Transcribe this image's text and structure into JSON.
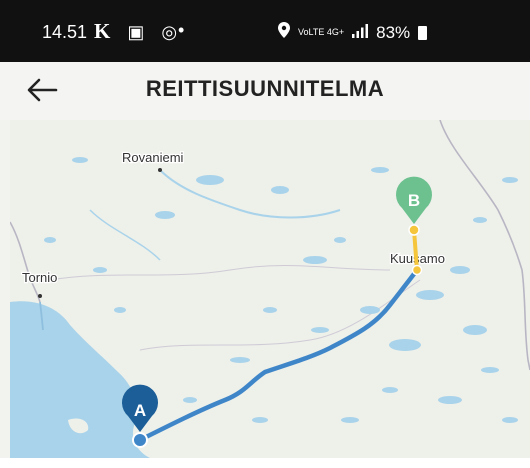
{
  "status_bar": {
    "time": "14.51",
    "left_icons": "K",
    "dot": "•",
    "network": "VoLTE 4G+",
    "battery": "83%"
  },
  "header": {
    "title": "REITTISUUNNITELMA"
  },
  "map": {
    "places": [
      "Rovaniemi",
      "Kuusamo",
      "Tornio"
    ],
    "marker_start": "A",
    "marker_end": "B",
    "colors": {
      "route": "#3f86c9",
      "marker_start": "#1b5e98",
      "marker_end": "#6cc18f",
      "water": "#a9d3ea",
      "land": "#eef0ea"
    }
  }
}
